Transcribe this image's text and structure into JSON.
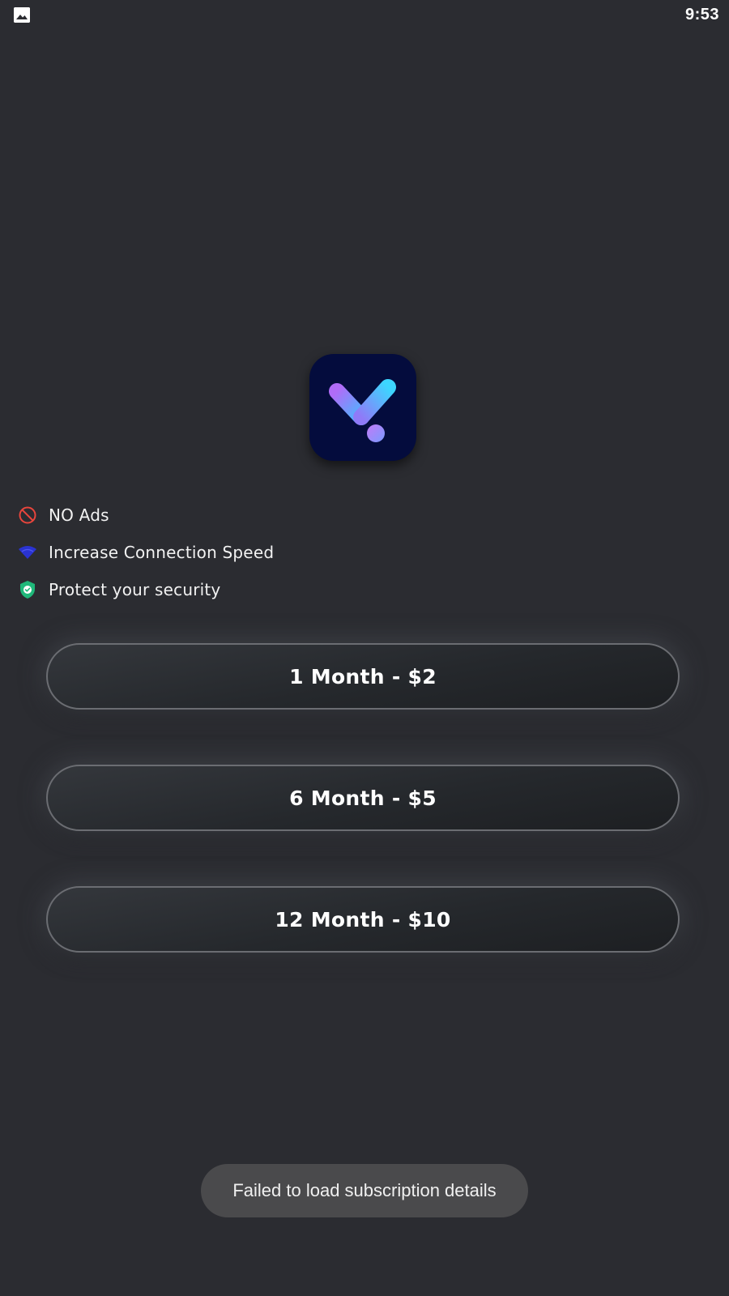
{
  "status_bar": {
    "time": "9:53",
    "left_icon": "image-icon"
  },
  "logo": {
    "icon": "app-logo-check-icon",
    "background_color": "#040c3d",
    "accent_gradient": [
      "#b06cf7",
      "#3dd6ff"
    ]
  },
  "features": [
    {
      "icon": "no-ads-icon",
      "label": "NO Ads",
      "color": "#e8453c"
    },
    {
      "icon": "wifi-icon",
      "label": "Increase Connection Speed",
      "color": "#2a33d1"
    },
    {
      "icon": "shield-check-icon",
      "label": "Protect your security",
      "color": "#1fb87a"
    }
  ],
  "plans": [
    {
      "label": "1 Month - $2"
    },
    {
      "label": "6 Month - $5"
    },
    {
      "label": "12 Month - $10"
    }
  ],
  "toast": {
    "message": "Failed to load subscription details"
  },
  "colors": {
    "background": "#2b2c31",
    "button_border": "#6b6d72",
    "toast_background": "#4a4a4c"
  }
}
